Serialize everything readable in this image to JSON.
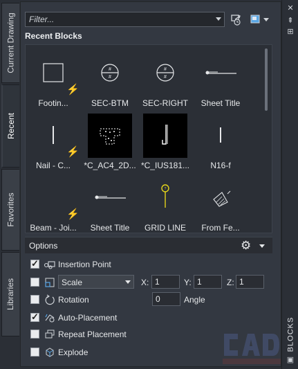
{
  "tabs": [
    {
      "label": "Current Drawing",
      "active": false
    },
    {
      "label": "Recent",
      "active": true
    },
    {
      "label": "Favorites",
      "active": false
    },
    {
      "label": "Libraries",
      "active": false
    }
  ],
  "filter": {
    "placeholder": "Filter..."
  },
  "section_title": "Recent Blocks",
  "blocks": [
    {
      "label": "Footin...",
      "icon": "rectangle-block-icon",
      "dynamic": true
    },
    {
      "label": "SEC-BTM",
      "icon": "section-marker-icon",
      "dynamic": false
    },
    {
      "label": "SEC-RIGHT",
      "icon": "section-marker-icon",
      "dynamic": false
    },
    {
      "label": "Sheet Title",
      "icon": "sheet-title-icon",
      "dynamic": false
    },
    {
      "label": "Nail - C...",
      "icon": "nail-icon",
      "dynamic": true
    },
    {
      "label": "*C_AC4_2D...",
      "icon": "steel-section-icon",
      "dynamic": false
    },
    {
      "label": "*C_IUS181...",
      "icon": "hanger-icon",
      "dynamic": false
    },
    {
      "label": "N16-f",
      "icon": "nail-icon",
      "dynamic": false
    },
    {
      "label": "Beam - Joi...",
      "icon": "beam-joist-icon",
      "dynamic": true
    },
    {
      "label": "Sheet Title",
      "icon": "sheet-title-icon",
      "dynamic": false
    },
    {
      "label": "GRID LINE",
      "icon": "grid-line-icon",
      "dynamic": false
    },
    {
      "label": "From Fe...",
      "icon": "hatched-block-icon",
      "dynamic": false
    }
  ],
  "options": {
    "title": "Options",
    "insertion_point": {
      "label": "Insertion Point",
      "checked": true
    },
    "scale": {
      "checked": false,
      "mode": "Scale",
      "x_label": "X:",
      "x": "1",
      "y_label": "Y:",
      "y": "1",
      "z_label": "Z:",
      "z": "1"
    },
    "rotation": {
      "label": "Rotation",
      "checked": false,
      "value": "0",
      "unit_label": "Angle"
    },
    "auto_placement": {
      "label": "Auto-Placement",
      "checked": true
    },
    "repeat_placement": {
      "label": "Repeat Placement",
      "checked": false
    },
    "explode": {
      "label": "Explode",
      "checked": false
    }
  },
  "palette_label": "BLOCKS",
  "colors": {
    "panel": "#333841",
    "bolt": "#f2b51c",
    "grid_line": "#e5d51a"
  }
}
